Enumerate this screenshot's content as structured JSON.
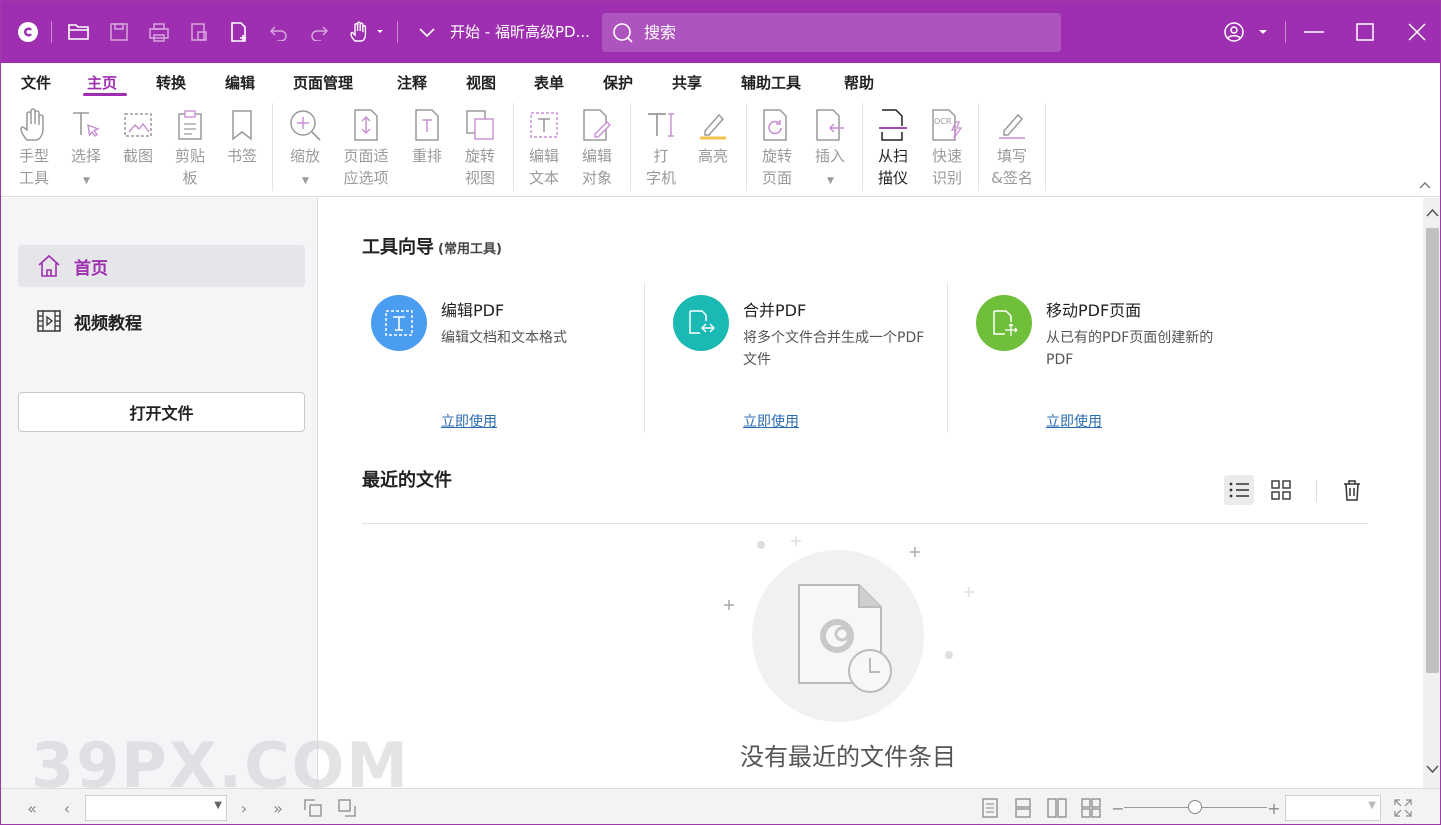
{
  "titlebar": {
    "title": "开始 - 福昕高级PD...",
    "search_placeholder": "搜索",
    "accent": "#9d2fb0"
  },
  "menu": [
    "文件",
    "主页",
    "转换",
    "编辑",
    "页面管理",
    "注释",
    "视图",
    "表单",
    "保护",
    "共享",
    "辅助工具",
    "帮助"
  ],
  "menu_active": "主页",
  "ribbon": {
    "hand": "手型\n工具",
    "select": "选择",
    "snapshot": "截图",
    "clipboard": "剪贴\n板",
    "bookmark": "书签",
    "zoom": "缩放",
    "fit": "页面适\n应选项",
    "reflow": "重排",
    "rotate_view": "旋转\n视图",
    "edit_text": "编辑\n文本",
    "edit_object": "编辑\n对象",
    "typewriter": "打\n字机",
    "highlight": "高亮",
    "rotate_page": "旋转\n页面",
    "insert": "插入",
    "scan": "从扫\n描仪",
    "ocr": "快速\n识别",
    "fill_sign": "填写\n&签名"
  },
  "sidebar": {
    "home": "首页",
    "video": "视频教程",
    "open_file": "打开文件"
  },
  "main": {
    "tools_title": "工具向导",
    "tools_subtitle": "(常用工具)",
    "tools": [
      {
        "name": "编辑PDF",
        "desc": "编辑文档和文本格式",
        "action": "立即使用",
        "color": "#4a9df0"
      },
      {
        "name": "合并PDF",
        "desc": "将多个文件合并生成一个PDF文件",
        "action": "立即使用",
        "color": "#1bb9b4"
      },
      {
        "name": "移动PDF页面",
        "desc": "从已有的PDF页面创建新的PDF",
        "action": "立即使用",
        "color": "#6fbf3a"
      }
    ],
    "recent_title": "最近的文件",
    "empty_text": "没有最近的文件条目"
  },
  "watermark": "39PX.COM"
}
